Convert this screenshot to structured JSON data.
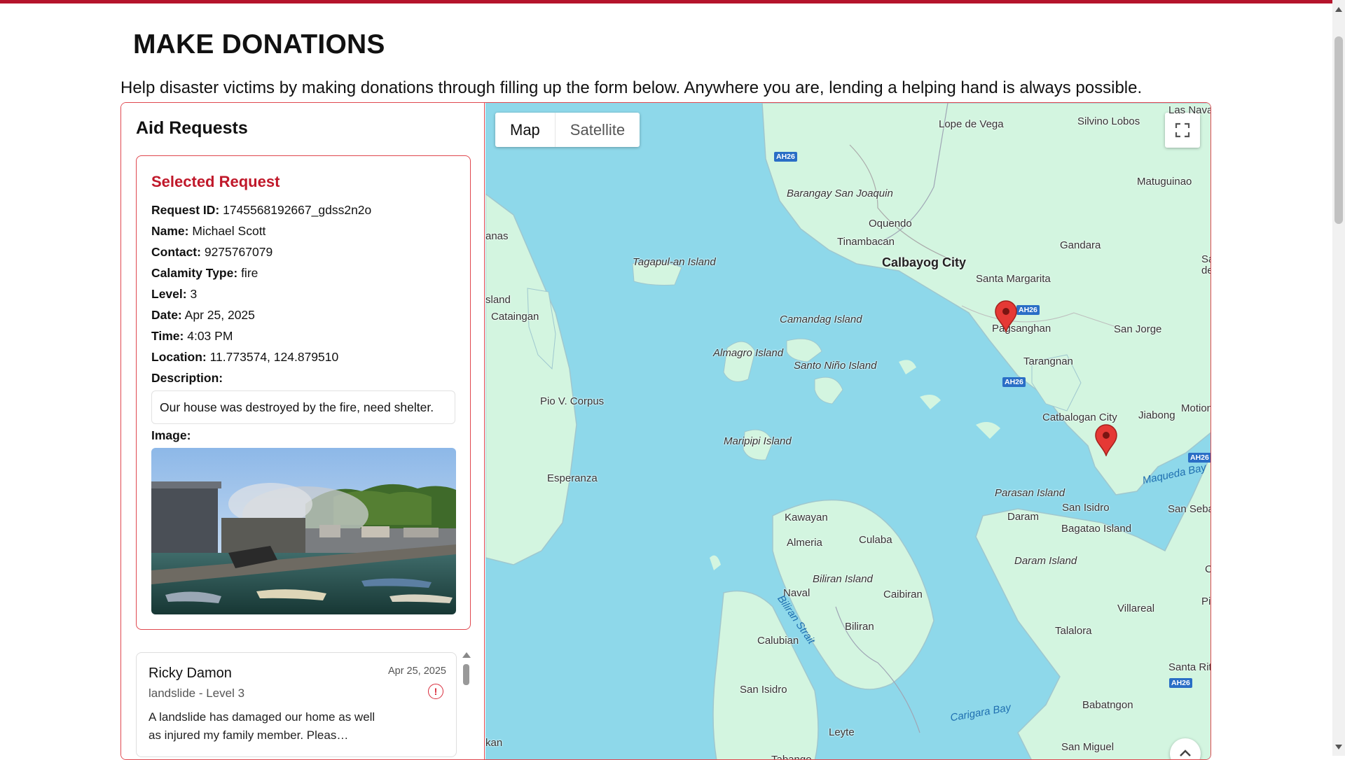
{
  "page": {
    "title": "MAKE DONATIONS",
    "intro": "Help disaster victims by making donations through filling up the form below. Anywhere you are, lending a helping hand is always possible."
  },
  "sidebar": {
    "title": "Aid Requests",
    "selected": {
      "heading": "Selected Request",
      "fields": [
        {
          "label": "Request ID:",
          "value": "1745568192667_gdss2n2o"
        },
        {
          "label": "Name:",
          "value": "Michael Scott"
        },
        {
          "label": "Contact:",
          "value": "9275767079"
        },
        {
          "label": "Calamity Type:",
          "value": "fire"
        },
        {
          "label": "Level:",
          "value": "3"
        },
        {
          "label": "Date:",
          "value": "Apr 25, 2025"
        },
        {
          "label": "Time:",
          "value": "4:03 PM"
        },
        {
          "label": "Location:",
          "value": "11.773574, 124.879510"
        },
        {
          "label": "Description:",
          "value": ""
        }
      ],
      "description": "Our house was destroyed by the fire, need shelter.",
      "image_label": "Image:"
    },
    "list": [
      {
        "name": "Ricky Damon",
        "date": "Apr 25, 2025",
        "type_level": "landslide - Level 3",
        "alert_icon": "!",
        "description": "A landslide has damaged our home as well as injured my family member. Pleas…"
      }
    ]
  },
  "map": {
    "type_options": [
      "Map",
      "Satellite"
    ],
    "selected_type": "Map",
    "places": {
      "calbayog": "Calbayog City",
      "lope": "Lope de Vega",
      "silvino": "Silvino Lobos",
      "lasnava": "Las Nava",
      "matuguinao": "Matuguinao",
      "barangay": "Barangay San Joaquin",
      "oquendo": "Oquendo",
      "tinambacan": "Tinambacan",
      "gandara": "Gandara",
      "tagapul": "Tagapul-an Island",
      "nas": "anas",
      "sland": "sland",
      "catai": "Cataingan",
      "santamargarita": "Santa Margarita",
      "paganghan": "Pagsanghan",
      "sanjorge": "San Jorge",
      "camandag": "Camandag Island",
      "almagro": "Almagro Island",
      "santonino": "Santo Niño Island",
      "tarangnan": "Tarangnan",
      "piov": "Pio V. Corpus",
      "catbalogan": "Catbalogan City",
      "jiabong": "Jiabong",
      "motion": "Motion",
      "maripipi": "Maripipi Island",
      "esperanza": "Esperanza",
      "maqueda": "Maqueda Bay",
      "parasan": "Parasan Island",
      "sanisidro": "San Isidro",
      "daram": "Daram",
      "bagatao": "Bagatao Island",
      "sanseba": "San Seba",
      "kawayan": "Kawayan",
      "almeria": "Almeria",
      "culaba": "Culaba",
      "daramisland": "Daram Island",
      "biliranisland": "Biliran Island",
      "naval": "Naval",
      "caibiran": "Caibiran",
      "biliranstrait": "Biliran Strait",
      "villareal": "Villareal",
      "biliran": "Biliran",
      "calubian": "Calubian",
      "talalora": "Talalora",
      "santarit": "Santa Rit",
      "sanisidro2": "San Isidro",
      "babatngon": "Babatngon",
      "carigara": "Carigara Bay",
      "leyte": "Leyte",
      "sanmiguel": "San Miguel",
      "kan": "kan",
      "tabango": "Tabango",
      "sa": "Sa de",
      "c": "C",
      "pi": "Pi"
    },
    "road_shield": "AH26",
    "marker_color": "#d9302c",
    "land_color": "#d3f5e0",
    "water_color": "#8ed8ea"
  }
}
